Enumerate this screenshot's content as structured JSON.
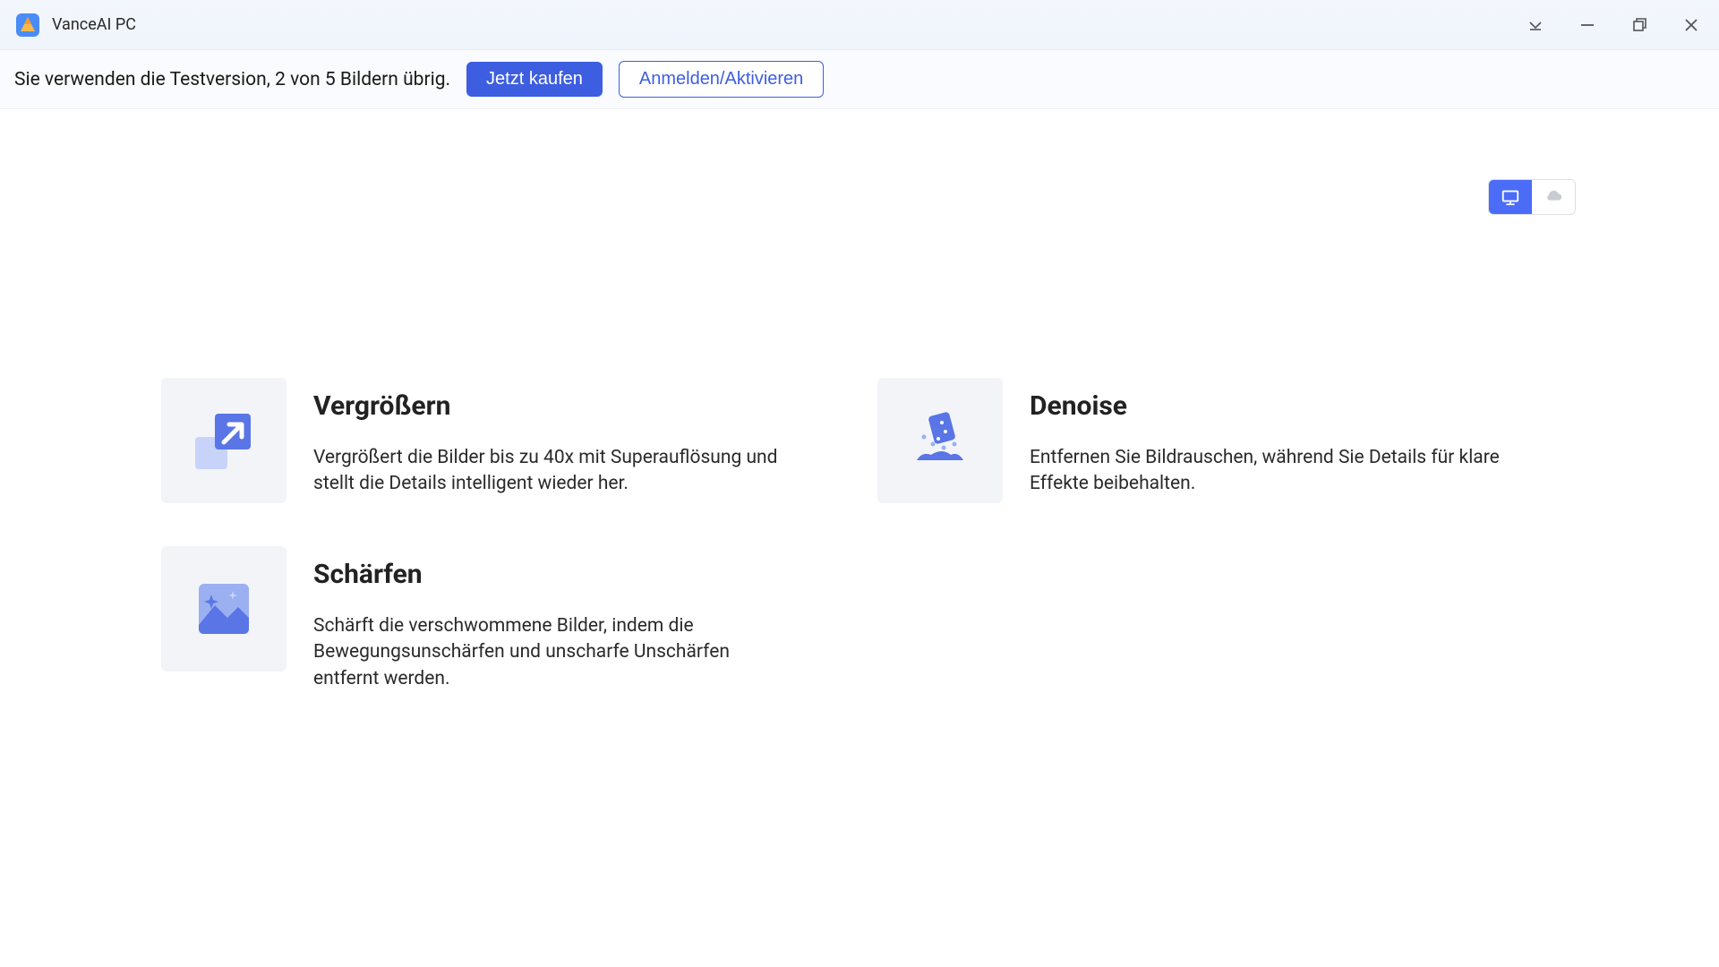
{
  "titlebar": {
    "app_title": "VanceAI PC"
  },
  "topbar": {
    "trial_text": "Sie verwenden die Testversion, 2 von 5 Bildern übrig.",
    "buy_now_label": "Jetzt kaufen",
    "login_label": "Anmelden/Aktivieren"
  },
  "cards": {
    "enlarge": {
      "title": "Vergrößern",
      "desc": "Vergrößert die Bilder bis zu 40x mit Superauflösung und stellt die Details intelligent wieder her."
    },
    "denoise": {
      "title": "Denoise",
      "desc": "Entfernen Sie Bildrauschen, während Sie Details für klare Effekte beibehalten."
    },
    "sharpen": {
      "title": "Schärfen",
      "desc": "Schärft die verschwommene Bilder, indem die Bewegungsunschärfen und unscharfe Unschärfen entfernt werden."
    }
  }
}
